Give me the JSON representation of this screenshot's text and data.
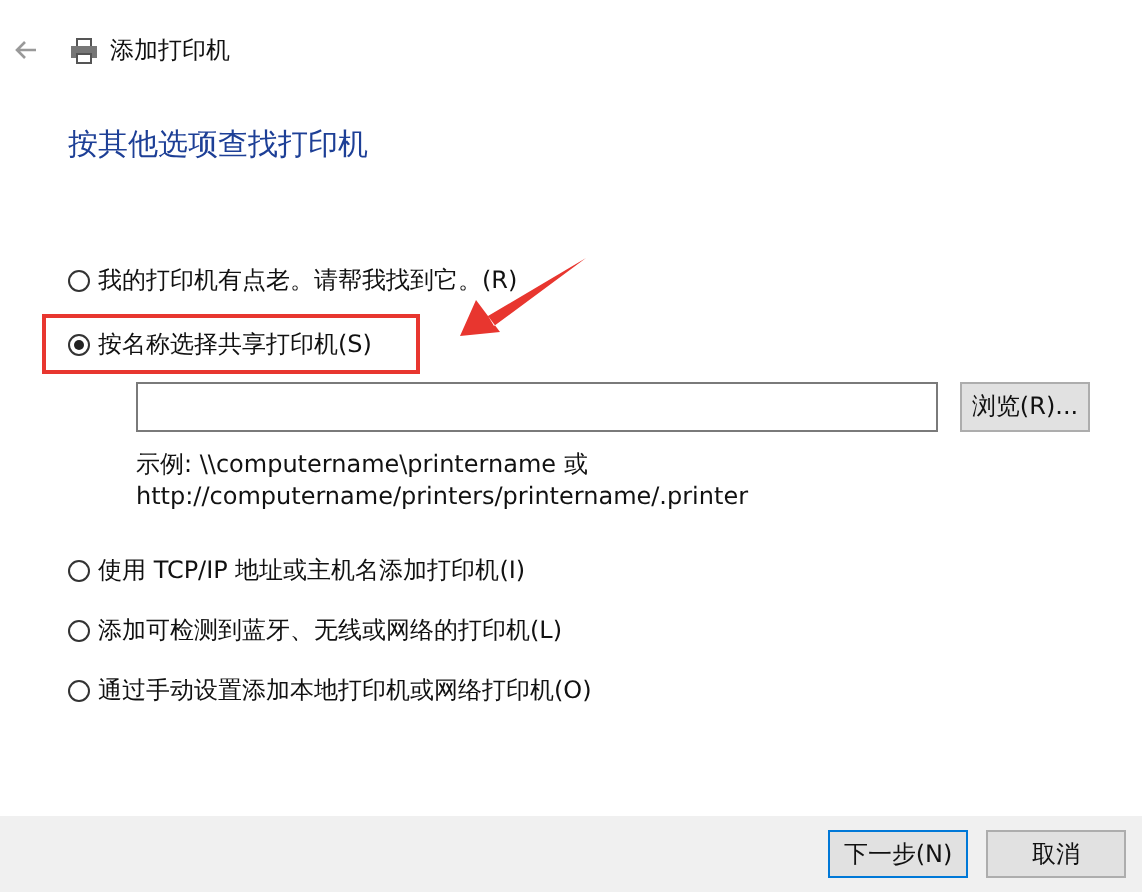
{
  "window": {
    "title": "添加打印机"
  },
  "heading": "按其他选项查找打印机",
  "options": [
    {
      "kind": "plain",
      "label": "我的打印机有点老。请帮我找到它。(R)",
      "selected": false
    },
    {
      "kind": "by_name",
      "label": "按名称选择共享打印机(S)",
      "selected": true,
      "browse_button": "浏览(R)...",
      "example": [
        "示例: \\\\computername\\printername 或",
        "http://computername/printers/printername/.printer"
      ]
    },
    {
      "kind": "plain",
      "label": "使用 TCP/IP 地址或主机名添加打印机(I)",
      "selected": false
    },
    {
      "kind": "plain",
      "label": "添加可检测到蓝牙、无线或网络的打印机(L)",
      "selected": false
    },
    {
      "kind": "plain",
      "label": "通过手动设置添加本地打印机或网络打印机(O)",
      "selected": false
    }
  ],
  "buttons": [
    {
      "label": "下一步(N)",
      "default": true
    },
    {
      "label": "取消",
      "default": false
    }
  ]
}
